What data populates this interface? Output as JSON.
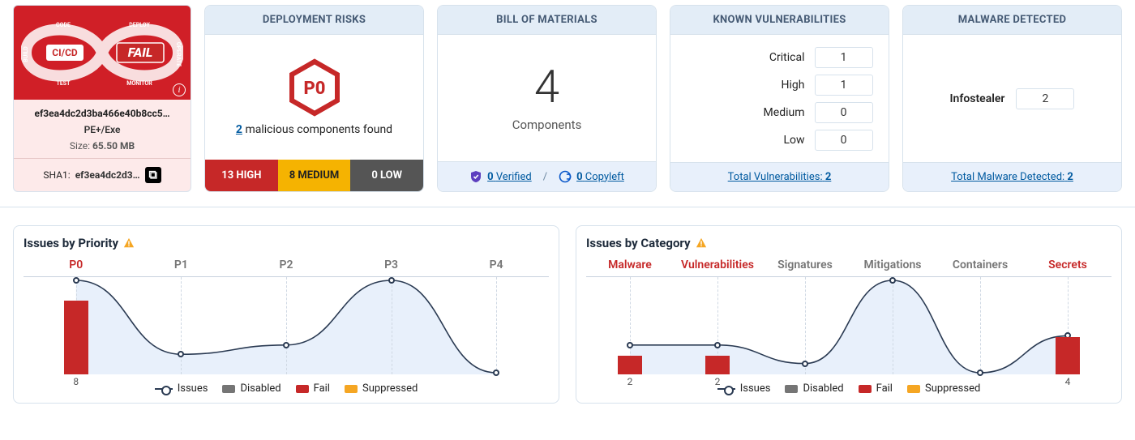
{
  "file": {
    "status_word": "FAIL",
    "cicd_label": "CI/CD",
    "loop_words": [
      "CODE",
      "DEPLOY",
      "OPERATE",
      "MONITOR",
      "TEST",
      "BUILD"
    ],
    "name": "ef3ea4dc2d3ba466e40b8cc5…",
    "type": "PE+/Exe",
    "size_label": "Size:",
    "size_value": "65.50 MB",
    "hash_label": "SHA1:",
    "hash_value": "ef3ea4dc2d3…"
  },
  "deployment_risks": {
    "title": "DEPLOYMENT RISKS",
    "p0_badge": "P0",
    "malicious_count": "2",
    "malicious_text": " malicious components found",
    "high": "13 HIGH",
    "medium": "8 MEDIUM",
    "low": "0 LOW"
  },
  "bom": {
    "title": "BILL OF MATERIALS",
    "count": "4",
    "label": "Components",
    "verified_count": "0",
    "verified_label": "Verified",
    "copyleft_count": "0",
    "copyleft_label": "Copyleft"
  },
  "vulns": {
    "title": "KNOWN VULNERABILITIES",
    "rows": [
      {
        "label": "Critical",
        "value": "1"
      },
      {
        "label": "High",
        "value": "1"
      },
      {
        "label": "Medium",
        "value": "0"
      },
      {
        "label": "Low",
        "value": "0"
      }
    ],
    "total_label": "Total Vulnerabilities:",
    "total_value": "2"
  },
  "malware": {
    "title": "MALWARE DETECTED",
    "rows": [
      {
        "label": "Infostealer",
        "value": "2"
      }
    ],
    "total_label": "Total Malware Detected:",
    "total_value": "2"
  },
  "legend": {
    "issues": "Issues",
    "disabled": "Disabled",
    "fail": "Fail",
    "suppressed": "Suppressed"
  },
  "priority_chart": {
    "title": "Issues by Priority",
    "categories": [
      "P0",
      "P1",
      "P2",
      "P3",
      "P4"
    ],
    "red_categories": [
      "P0"
    ],
    "fail_bars": [
      {
        "cat": "P0",
        "value": 8
      }
    ]
  },
  "category_chart": {
    "title": "Issues by Category",
    "categories": [
      "Malware",
      "Vulnerabilities",
      "Signatures",
      "Mitigations",
      "Containers",
      "Secrets"
    ],
    "red_categories": [
      "Malware",
      "Vulnerabilities",
      "Secrets"
    ],
    "fail_bars": [
      {
        "cat": "Malware",
        "value": 2
      },
      {
        "cat": "Vulnerabilities",
        "value": 2
      },
      {
        "cat": "Secrets",
        "value": 4
      }
    ]
  },
  "chart_data": [
    {
      "type": "line",
      "title": "Issues by Priority",
      "categories": [
        "P0",
        "P1",
        "P2",
        "P3",
        "P4"
      ],
      "series": [
        {
          "name": "Issues",
          "values": [
            10,
            2,
            3,
            10,
            0
          ]
        },
        {
          "name": "Fail",
          "values": [
            8,
            0,
            0,
            0,
            0
          ]
        },
        {
          "name": "Disabled",
          "values": [
            0,
            0,
            0,
            0,
            0
          ]
        },
        {
          "name": "Suppressed",
          "values": [
            0,
            0,
            0,
            0,
            0
          ]
        }
      ],
      "ylim": [
        0,
        10
      ]
    },
    {
      "type": "line",
      "title": "Issues by Category",
      "categories": [
        "Malware",
        "Vulnerabilities",
        "Signatures",
        "Mitigations",
        "Containers",
        "Secrets"
      ],
      "series": [
        {
          "name": "Issues",
          "values": [
            3,
            3,
            1,
            10,
            0,
            4
          ]
        },
        {
          "name": "Fail",
          "values": [
            2,
            2,
            0,
            0,
            0,
            4
          ]
        },
        {
          "name": "Disabled",
          "values": [
            0,
            0,
            0,
            0,
            0,
            0
          ]
        },
        {
          "name": "Suppressed",
          "values": [
            0,
            0,
            0,
            0,
            0,
            0
          ]
        }
      ],
      "ylim": [
        0,
        10
      ]
    }
  ]
}
